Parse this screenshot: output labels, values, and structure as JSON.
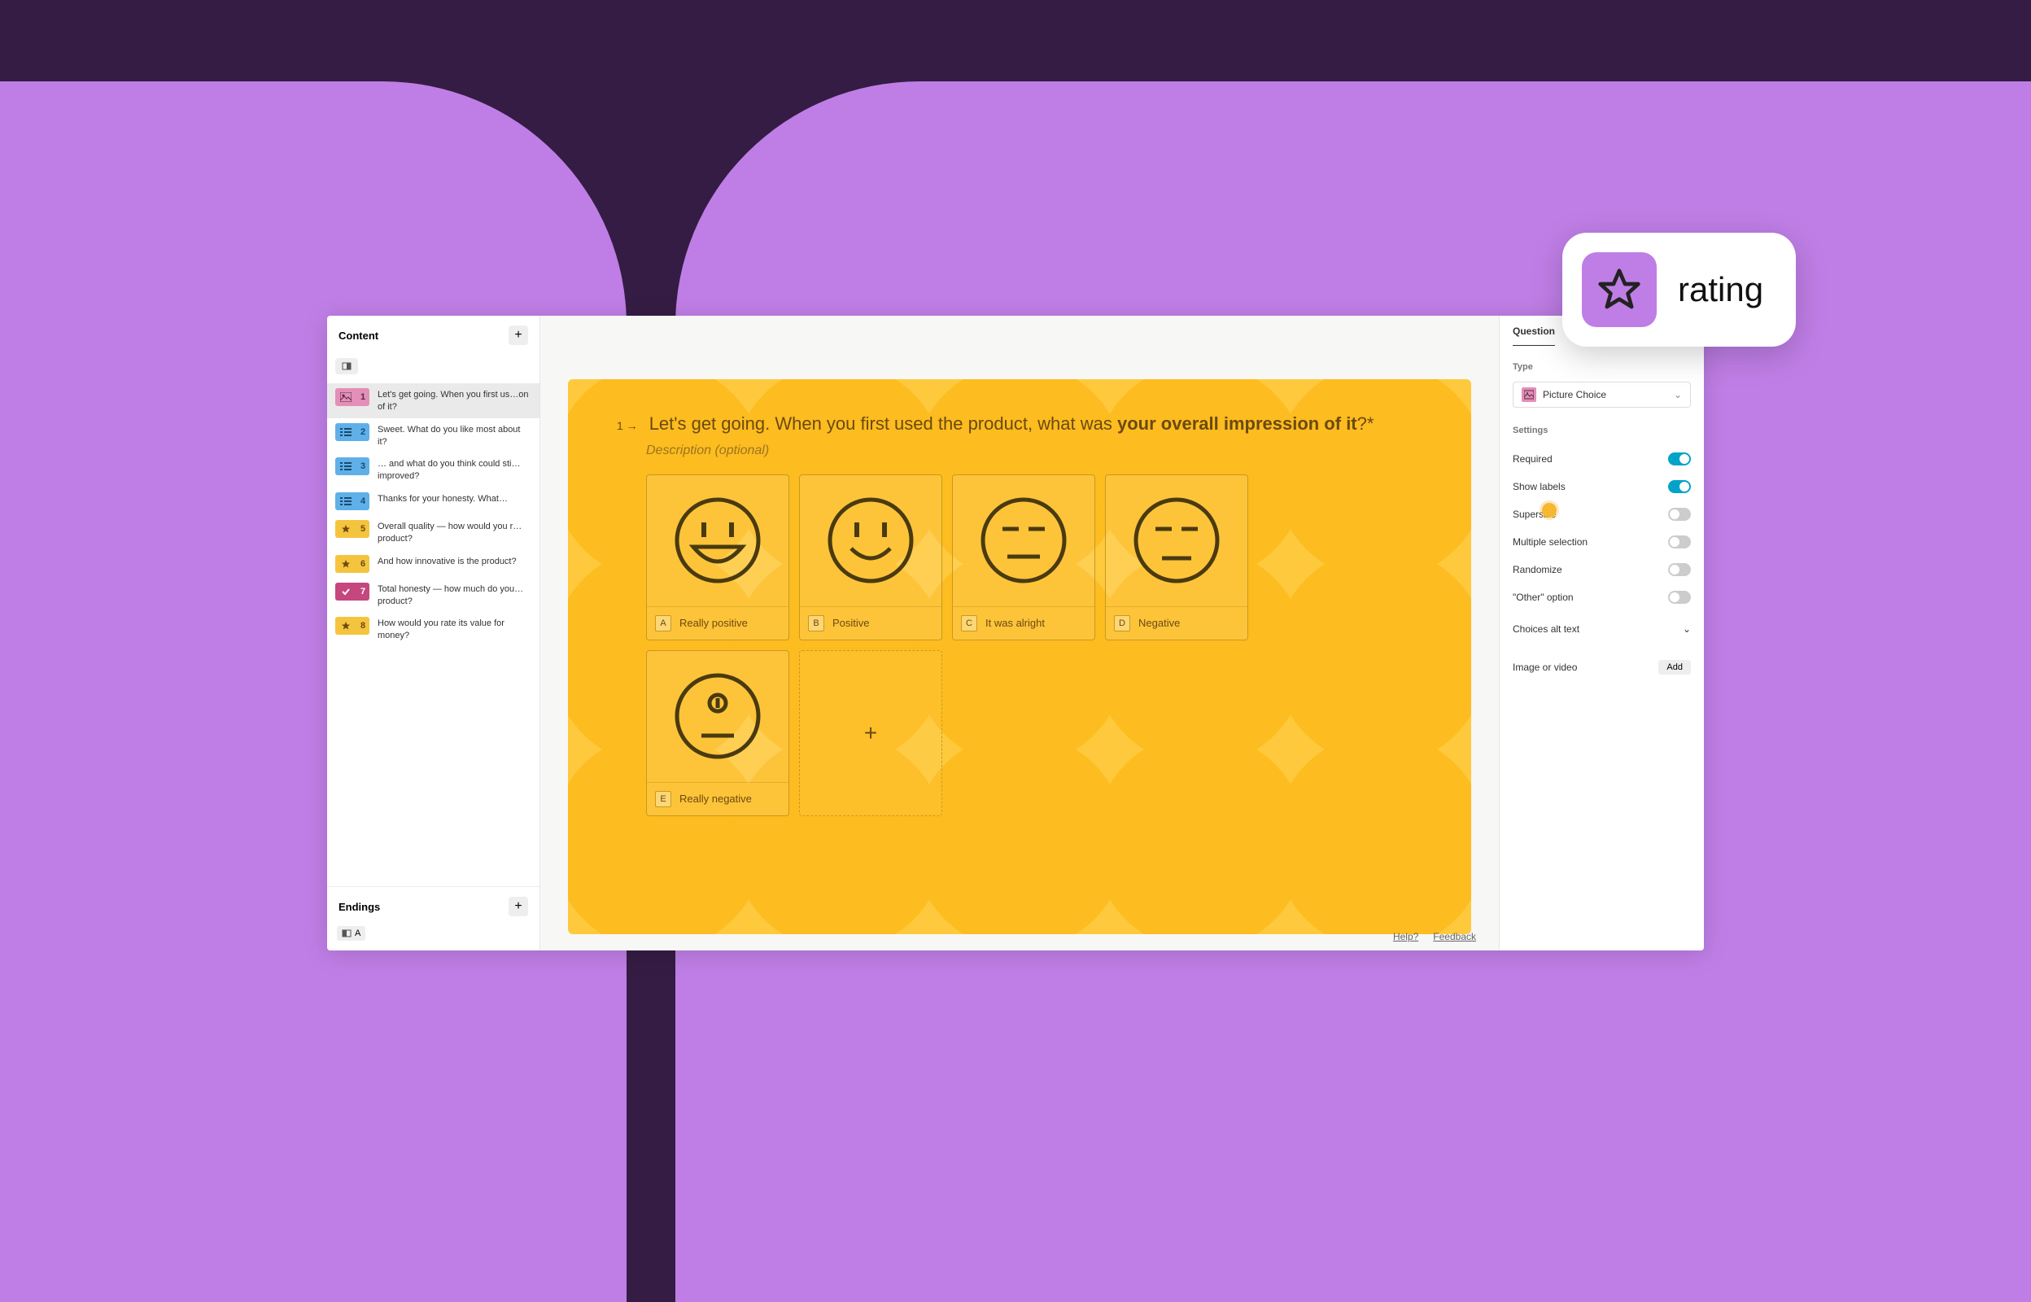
{
  "sidebar": {
    "content_title": "Content",
    "endings_title": "Endings",
    "ending_label": "A",
    "items": [
      {
        "num": "1",
        "text": "Let's get going. When you first us…on of it?",
        "color": "pink",
        "icon": "image"
      },
      {
        "num": "2",
        "text": "Sweet. What do you like most about it?",
        "color": "blue",
        "icon": "list"
      },
      {
        "num": "3",
        "text": "… and what do you think could sti…improved?",
        "color": "blue",
        "icon": "list"
      },
      {
        "num": "4",
        "text": "Thanks for your honesty. What…",
        "color": "blue",
        "icon": "list"
      },
      {
        "num": "5",
        "text": "Overall quality — how would you r… product?",
        "color": "yellow",
        "icon": "star"
      },
      {
        "num": "6",
        "text": "And how innovative is the product?",
        "color": "yellow",
        "icon": "star"
      },
      {
        "num": "7",
        "text": "Total honesty — how much do you… product?",
        "color": "magenta",
        "icon": "check"
      },
      {
        "num": "8",
        "text": "How would you rate its value for money?",
        "color": "yellow",
        "icon": "star"
      }
    ]
  },
  "question": {
    "number": "1 →",
    "prefix": "Let's get going. When you first used the product, what was ",
    "bold": "your overall impression of it",
    "suffix": "?*",
    "description": "Description (optional)",
    "choices": [
      {
        "key": "A",
        "label": "Really positive"
      },
      {
        "key": "B",
        "label": "Positive"
      },
      {
        "key": "C",
        "label": "It was alright"
      },
      {
        "key": "D",
        "label": "Negative"
      },
      {
        "key": "E",
        "label": "Really negative"
      }
    ]
  },
  "footer": {
    "help": "Help?",
    "feedback": "Feedback"
  },
  "right": {
    "tab": "Question",
    "type_label": "Type",
    "type_value": "Picture Choice",
    "settings_label": "Settings",
    "settings": [
      {
        "label": "Required",
        "on": true
      },
      {
        "label": "Show labels",
        "on": true
      },
      {
        "label": "Supersize",
        "on": false
      },
      {
        "label": "Multiple selection",
        "on": false
      },
      {
        "label": "Randomize",
        "on": false
      },
      {
        "label": "\"Other\" option",
        "on": false
      }
    ],
    "alt_text": "Choices alt text",
    "image_label": "Image or video",
    "add_btn": "Add"
  },
  "callout": {
    "text": "rating"
  }
}
